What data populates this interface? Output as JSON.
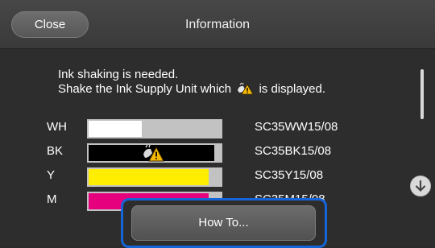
{
  "header": {
    "close_label": "Close",
    "title": "Information"
  },
  "message": {
    "line1": "Ink shaking is needed.",
    "line2_before": "Shake the Ink Supply Unit which",
    "line2_after": "is displayed.",
    "inline_icon": "ink-shake-warning-icon"
  },
  "ink_rows": [
    {
      "code": "WH",
      "part": "SC35WW15/08",
      "level": 0.4,
      "fill_color": "#ffffff",
      "shake_warning": false
    },
    {
      "code": "BK",
      "part": "SC35BK15/08",
      "level": 0.95,
      "fill_color": "#000000",
      "shake_warning": true
    },
    {
      "code": "Y",
      "part": "SC35Y15/08",
      "level": 0.91,
      "fill_color": "#ffee00",
      "shake_warning": false
    },
    {
      "code": "M",
      "part": "SC35M15/08",
      "level": 0.91,
      "fill_color": "#e6007e",
      "shake_warning": false
    }
  ],
  "footer": {
    "how_to_label": "How To..."
  },
  "colors": {
    "background": "#2d2d2d",
    "focus_ring": "#1565d8",
    "bar_track": "#c2c2c2"
  }
}
